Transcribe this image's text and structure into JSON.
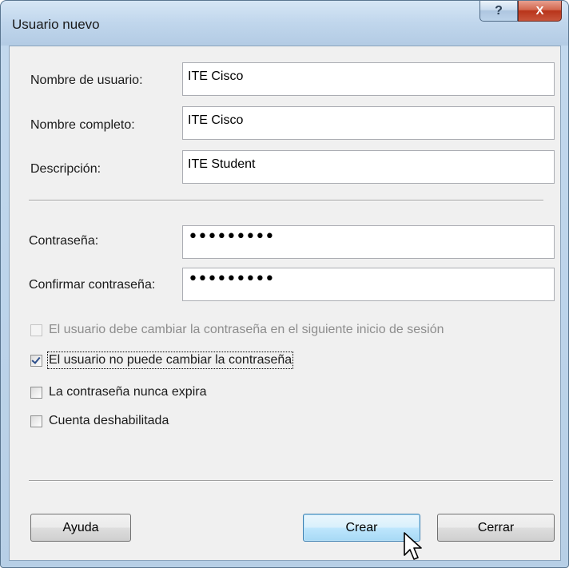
{
  "window": {
    "title": "Usuario nuevo",
    "help_glyph": "?",
    "close_glyph": "X"
  },
  "form": {
    "username_label": "Nombre de usuario:",
    "username_value": "ITE Cisco",
    "fullname_label": "Nombre completo:",
    "fullname_value": "ITE Cisco",
    "description_label": "Descripción:",
    "description_value": "ITE Student",
    "password_label": "Contraseña:",
    "password_value": "•••••••••",
    "confirm_label": "Confirmar contraseña:",
    "confirm_value": "•••••••••"
  },
  "options": [
    {
      "label": "El usuario debe cambiar la contraseña en el siguiente inicio de sesión",
      "checked": false,
      "disabled": true
    },
    {
      "label": "El usuario no puede cambiar la contraseña",
      "checked": true,
      "disabled": false
    },
    {
      "label": "La contraseña nunca expira",
      "checked": false,
      "disabled": false
    },
    {
      "label": "Cuenta deshabilitada",
      "checked": false,
      "disabled": false
    }
  ],
  "buttons": {
    "help": "Ayuda",
    "create": "Crear",
    "close": "Cerrar"
  },
  "colors": {
    "title_gradient": "#c0d6ec",
    "close_button": "#c8553b",
    "default_button": "#bee6fd"
  }
}
